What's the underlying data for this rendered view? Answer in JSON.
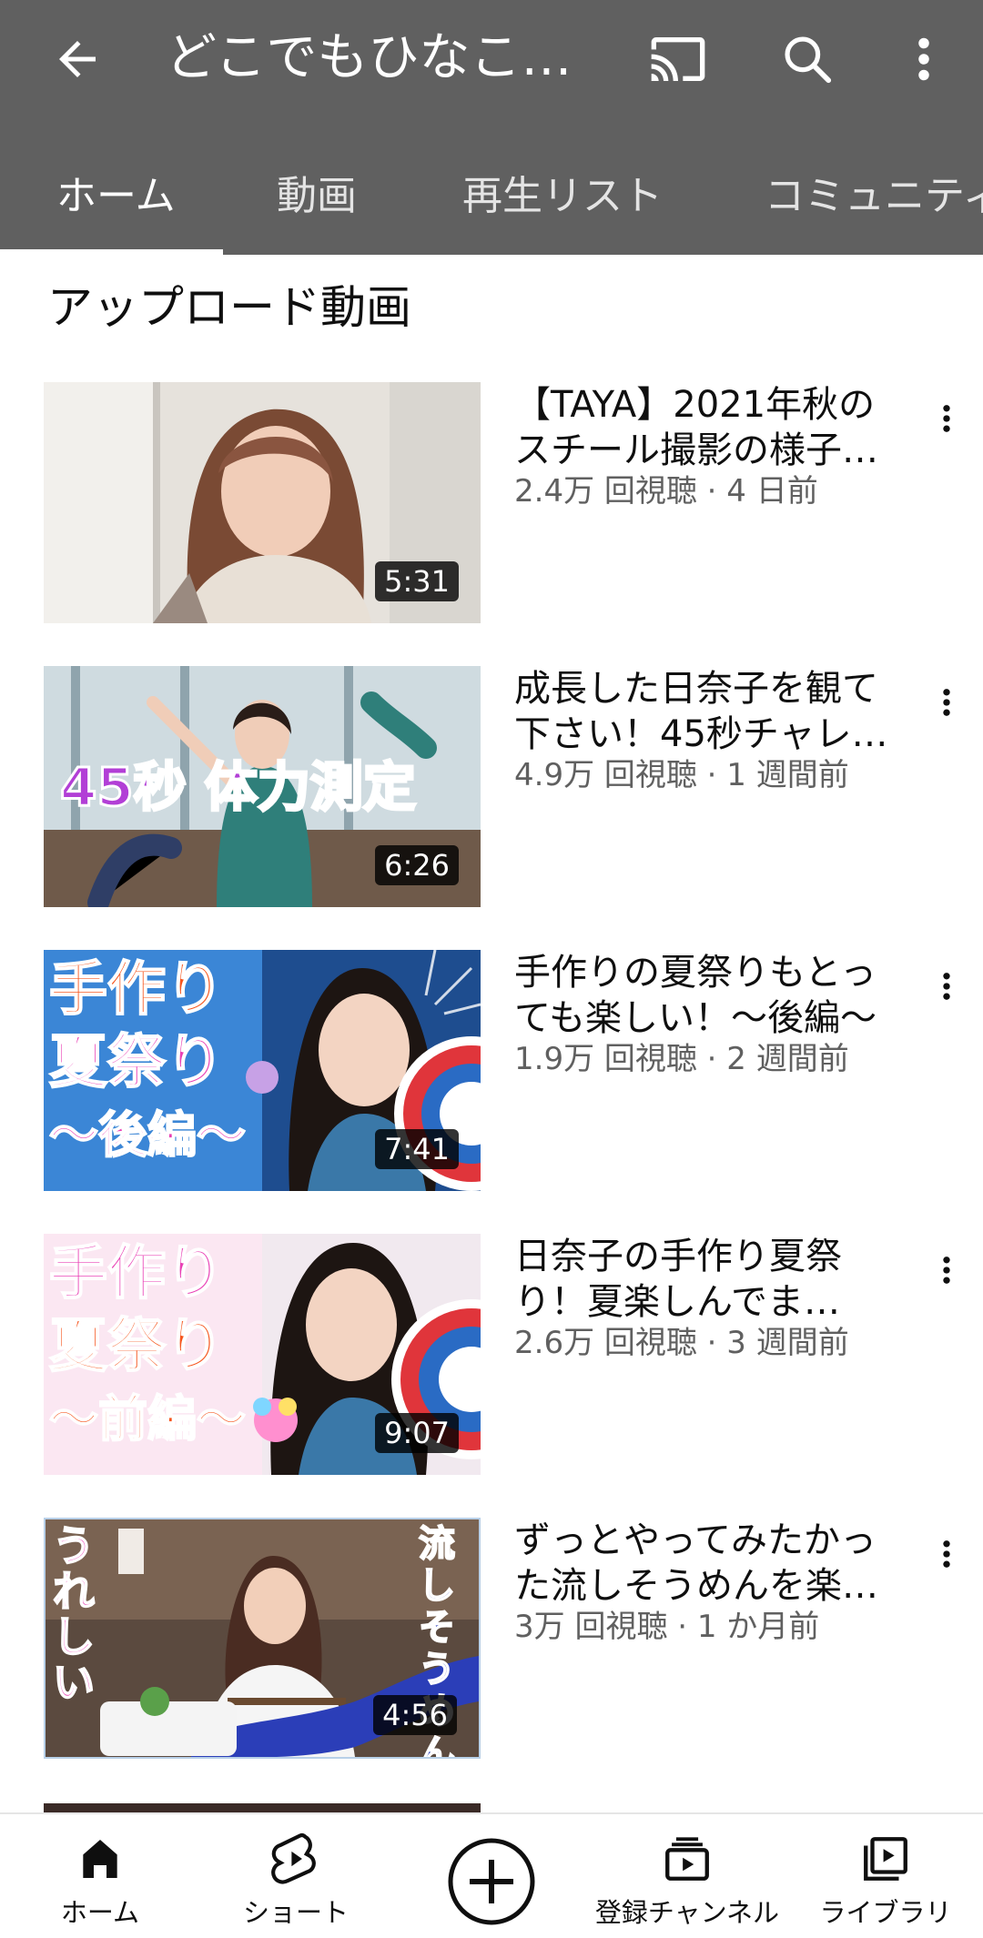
{
  "header": {
    "title": "どこでもひなこ…"
  },
  "tabs": [
    {
      "label": "ホーム",
      "active": true
    },
    {
      "label": "動画"
    },
    {
      "label": "再生リスト"
    },
    {
      "label": "コミュニティ"
    }
  ],
  "section": {
    "title": "アップロード動画"
  },
  "videos": [
    {
      "title": "【TAYA】2021年秋のスチール撮影の様子…",
      "meta": "2.4万 回視聴 · 4 日前",
      "duration": "5:31"
    },
    {
      "title": "成長した日奈子を観て下さい！45秒チャレ…",
      "meta": "4.9万 回視聴 · 1 週間前",
      "duration": "6:26",
      "thumb_text": "45秒 体力測定"
    },
    {
      "title": "手作りの夏祭りもとっても楽しい！〜後編〜",
      "meta": "1.9万 回視聴 · 2 週間前",
      "duration": "7:41",
      "thumb_text": [
        "手作り",
        "夏祭り",
        "〜後編〜"
      ]
    },
    {
      "title": "日奈子の手作り夏祭り！夏楽しんでま…",
      "meta": "2.6万 回視聴 · 3 週間前",
      "duration": "9:07",
      "thumb_text": [
        "手作り",
        "夏祭り",
        "〜前編〜"
      ]
    },
    {
      "title": "ずっとやってみたかった流しそうめんを楽…",
      "meta": "3万 回視聴 · 1 か月前",
      "duration": "4:56",
      "thumb_text": [
        "うれしい",
        "流しそうめん"
      ]
    }
  ],
  "bottom_nav": [
    {
      "label": "ホーム",
      "icon": "home-icon"
    },
    {
      "label": "ショート",
      "icon": "shorts-icon"
    },
    {
      "label": "",
      "icon": "create-icon"
    },
    {
      "label": "登録チャンネル",
      "icon": "subscriptions-icon"
    },
    {
      "label": "ライブラリ",
      "icon": "library-icon"
    }
  ],
  "colors": {
    "header_bg": "#606060",
    "text": "#0f0f0f",
    "meta": "#606060"
  }
}
